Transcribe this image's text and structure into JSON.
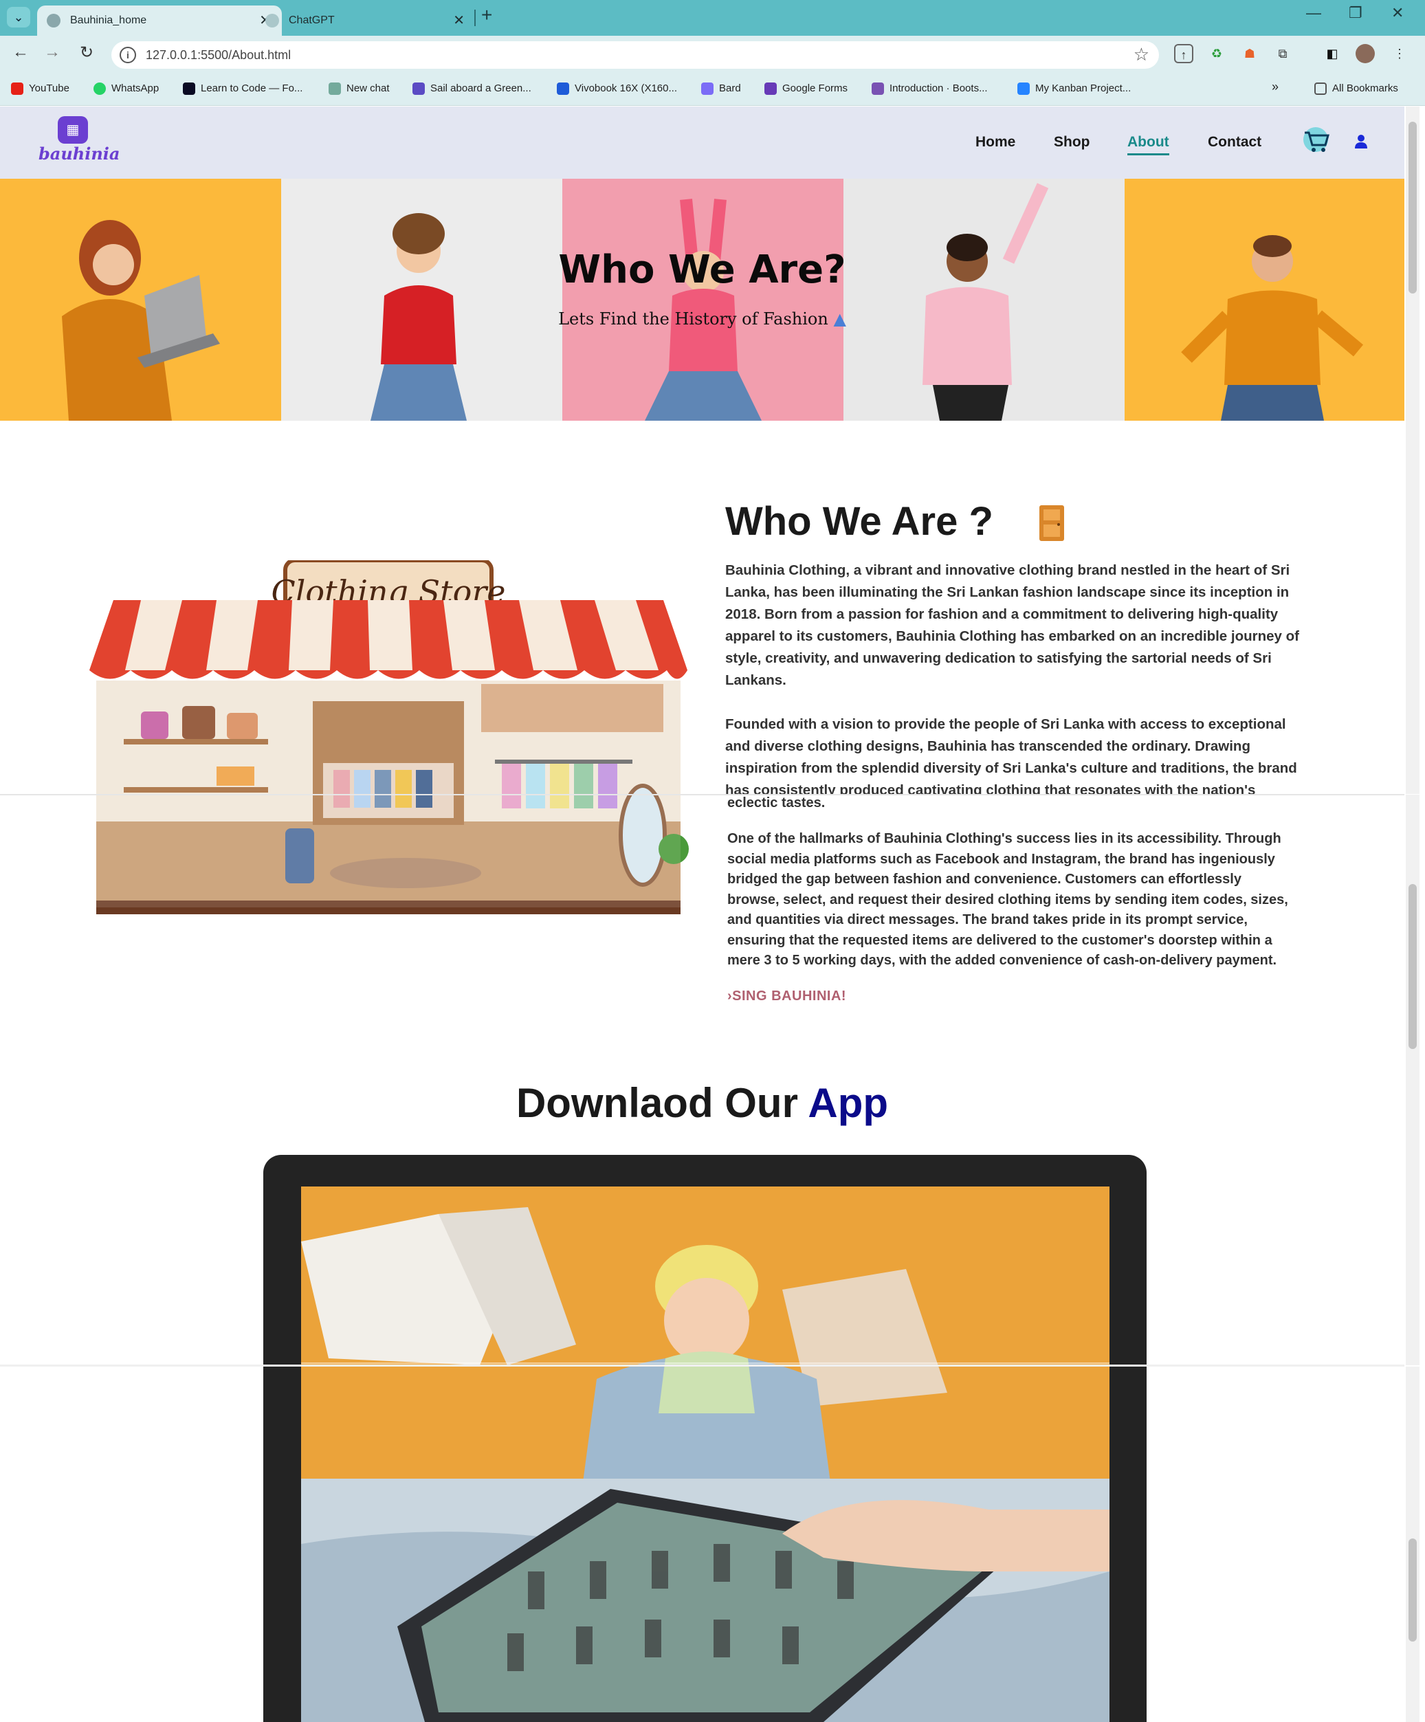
{
  "browser": {
    "tabs": [
      {
        "title": "Bauhinia_home",
        "active": true
      },
      {
        "title": "ChatGPT",
        "active": false
      }
    ],
    "url": "127.0.0.1:5500/About.html",
    "bookmarks": [
      {
        "label": "YouTube",
        "color": "#e62117"
      },
      {
        "label": "WhatsApp",
        "color": "#25d366"
      },
      {
        "label": "Learn to Code — Fo...",
        "color": "#0a0a23"
      },
      {
        "label": "New chat",
        "color": "#74aa9c"
      },
      {
        "label": "Sail aboard a Green...",
        "color": "#5b4bc4"
      },
      {
        "label": "Vivobook 16X (X160...",
        "color": "#1e5bd8"
      },
      {
        "label": "Bard",
        "color": "#7b6cf6"
      },
      {
        "label": "Google Forms",
        "color": "#673ab7"
      },
      {
        "label": "Introduction · Boots...",
        "color": "#7952b3"
      },
      {
        "label": "My Kanban Project...",
        "color": "#2684ff"
      }
    ],
    "bookmarks_more": "»",
    "all_bookmarks": "All Bookmarks"
  },
  "site": {
    "logo_text": "bauhinia",
    "nav": [
      {
        "label": "Home",
        "active": false
      },
      {
        "label": "Shop",
        "active": false
      },
      {
        "label": "About",
        "active": true
      },
      {
        "label": "Contact",
        "active": false
      }
    ],
    "accent_color": "#1a8a8a",
    "brand_color": "#6b3fd1"
  },
  "hero": {
    "title": "Who We Are?",
    "subtitle": "Lets Find the History of Fashion"
  },
  "about": {
    "store_sign": "Clothing Store",
    "title": "Who We Are ?",
    "p1_lines": [
      "Bauhinia Clothing, a vibrant and innovative clothing brand nestled in the heart of Sri",
      "Lanka, has been illuminating the Sri Lankan fashion landscape since its inception in",
      "2018. Born from a passion for fashion and a commitment to delivering high-quality",
      "apparel to its customers, Bauhinia Clothing has embarked on an incredible journey of",
      "style, creativity, and unwavering dedication to satisfying the sartorial needs of Sri",
      "Lankans."
    ],
    "p2_lines": [
      "Founded with a vision to provide the people of Sri Lanka with access to exceptional",
      "and diverse clothing designs, Bauhinia has transcended the ordinary. Drawing",
      "inspiration from the splendid diversity of Sri Lanka's culture and traditions, the brand",
      "has consistently produced captivating clothing that resonates with the nation's"
    ],
    "p2_tail": "eclectic tastes.",
    "p3_lines": [
      "One of the hallmarks of Bauhinia Clothing's success lies in its accessibility. Through",
      "social media platforms such as Facebook and Instagram, the brand has ingeniously",
      "bridged the gap between fashion and convenience. Customers can effortlessly",
      "browse, select, and request their desired clothing items by sending item codes, sizes,",
      "and quantities via direct messages. The brand takes pride in its prompt service,",
      "ensuring that the requested items are delivered to the customer's doorstep within a",
      "mere 3 to 5 working days, with the added convenience of cash-on-delivery payment."
    ],
    "cta": "›SING BAUHINIA!"
  },
  "app_section": {
    "title_part1": "Downlaod Our",
    "title_part2": "App"
  }
}
